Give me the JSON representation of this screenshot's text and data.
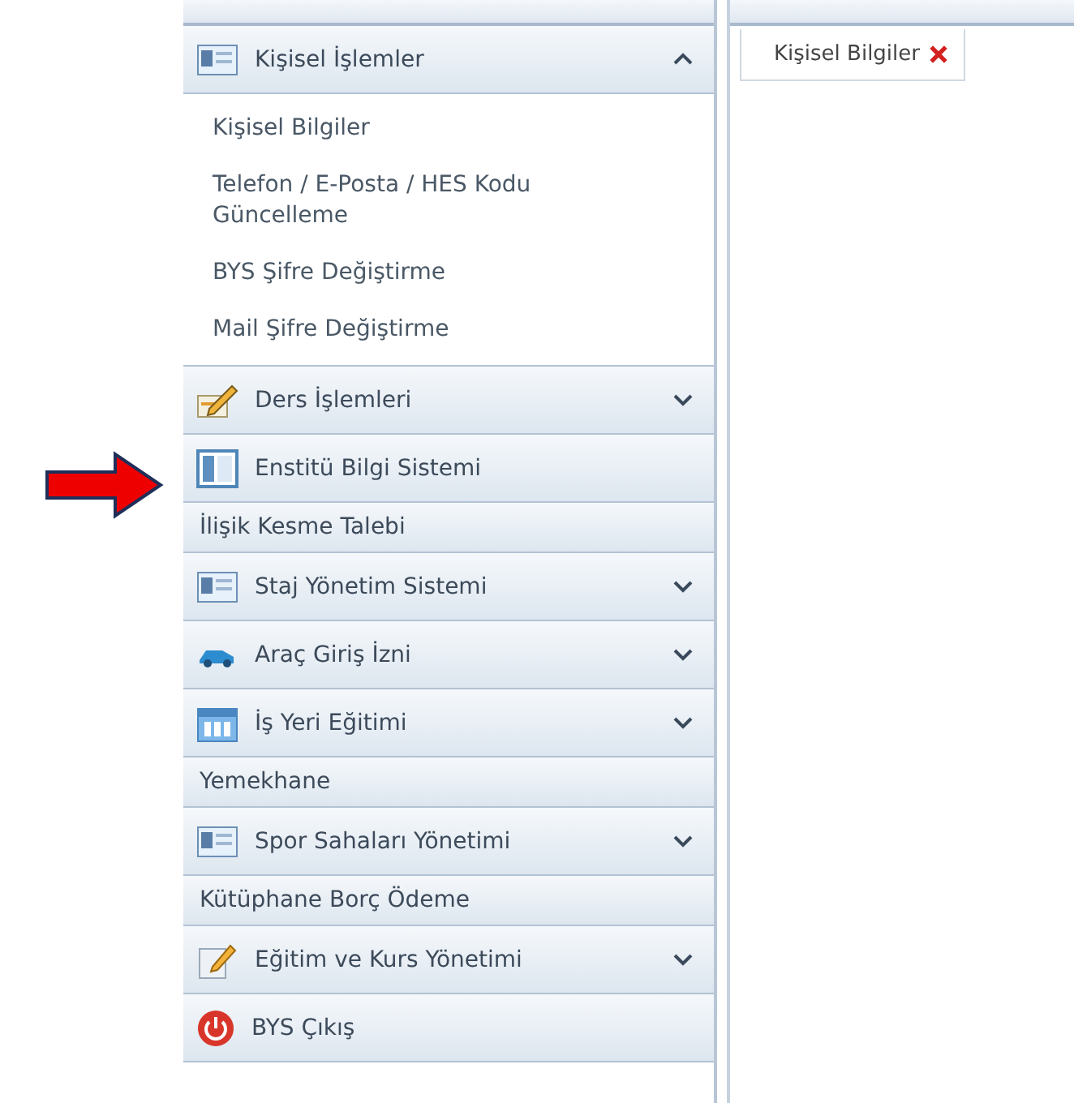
{
  "sidebar": {
    "items": [
      {
        "kind": "group",
        "label": "Kişisel İşlemler",
        "expanded": true,
        "children": [
          {
            "label": "Kişisel Bilgiler"
          },
          {
            "label": "Telefon / E-Posta / HES Kodu Güncelleme"
          },
          {
            "label": "BYS Şifre Değiştirme"
          },
          {
            "label": "Mail Şifre Değiştirme"
          }
        ]
      },
      {
        "kind": "group",
        "label": "Ders İşlemleri",
        "expanded": false
      },
      {
        "kind": "icon-link",
        "label": "Enstitü Bilgi Sistemi"
      },
      {
        "kind": "link",
        "label": "İlişik Kesme Talebi"
      },
      {
        "kind": "group",
        "label": "Staj Yönetim Sistemi",
        "expanded": false
      },
      {
        "kind": "group",
        "label": "Araç Giriş İzni",
        "expanded": false
      },
      {
        "kind": "group",
        "label": "İş Yeri Eğitimi",
        "expanded": false
      },
      {
        "kind": "link",
        "label": "Yemekhane"
      },
      {
        "kind": "group",
        "label": "Spor Sahaları Yönetimi",
        "expanded": false
      },
      {
        "kind": "link",
        "label": "Kütüphane Borç Ödeme"
      },
      {
        "kind": "group",
        "label": "Eğitim ve Kurs Yönetimi",
        "expanded": false
      },
      {
        "kind": "icon-link",
        "label": "BYS Çıkış"
      }
    ]
  },
  "tabs": [
    {
      "label": "Kişisel Bilgiler",
      "selected": true
    }
  ]
}
